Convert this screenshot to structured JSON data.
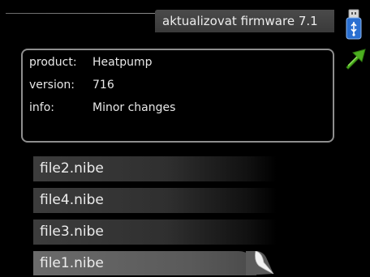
{
  "header": {
    "title": "aktualizovat firmware 7.1"
  },
  "icons": {
    "usb": "usb-icon",
    "back": "back-arrow-icon"
  },
  "info": {
    "product_label": "product:",
    "product_value": "Heatpump",
    "version_label": "version:",
    "version_value": "716",
    "info_label": "info:",
    "info_value": "Minor changes"
  },
  "files": [
    {
      "name": "file2.nibe"
    },
    {
      "name": "file4.nibe"
    },
    {
      "name": "file3.nibe"
    },
    {
      "name": "file1.nibe"
    }
  ],
  "colors": {
    "background": "#000000",
    "panel_border": "#8e8e8e",
    "selected_item": "#5f5f5f",
    "back_arrow": "#4caf1f",
    "usb_blue": "#2a6fd1"
  }
}
